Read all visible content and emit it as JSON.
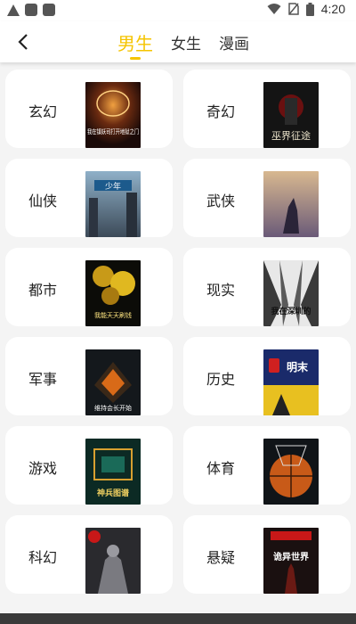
{
  "status_bar": {
    "time": "4:20"
  },
  "header": {
    "tabs": [
      {
        "label": "男生",
        "active": true
      },
      {
        "label": "女生",
        "active": false
      },
      {
        "label": "漫画",
        "active": false
      }
    ]
  },
  "categories": [
    {
      "label": "玄幻",
      "cover_text": "我在镇妖司打开地狱之门"
    },
    {
      "label": "奇幻",
      "cover_text": "巫界征途"
    },
    {
      "label": "仙侠",
      "cover_text": "少年"
    },
    {
      "label": "武侠",
      "cover_text": ""
    },
    {
      "label": "都市",
      "cover_text": "我能天天刷钱"
    },
    {
      "label": "现实",
      "cover_text": "我在深圳的"
    },
    {
      "label": "军事",
      "cover_text": "维持会长开始"
    },
    {
      "label": "历史",
      "cover_text": "明末"
    },
    {
      "label": "游戏",
      "cover_text": "神兵图谱"
    },
    {
      "label": "体育",
      "cover_text": ""
    },
    {
      "label": "科幻",
      "cover_text": ""
    },
    {
      "label": "悬疑",
      "cover_text": "诡异世界"
    }
  ],
  "colors": {
    "accent": "#f5c400",
    "text": "#222222",
    "background": "#f4f4f4"
  }
}
